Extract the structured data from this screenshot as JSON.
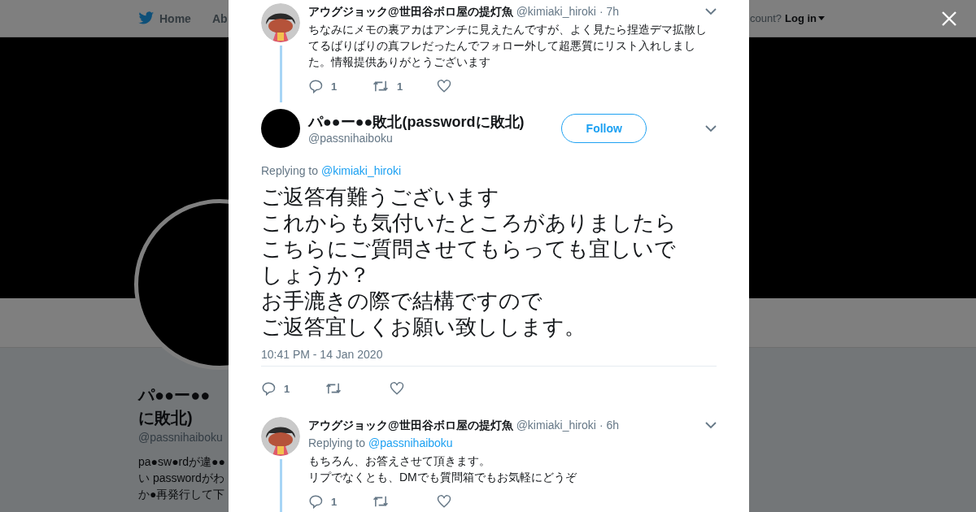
{
  "background_page": {
    "nav": {
      "items": [
        {
          "label": "Home"
        },
        {
          "label": "Ab"
        }
      ],
      "account_prompt": "count?",
      "login": "Log in"
    },
    "profile": {
      "name_lines": [
        "パ●●ー●●",
        "に敗北)"
      ],
      "handle": "@passnihaiboku",
      "bio_lines": [
        "pa●sw●rdが違●●",
        "い passwordがわ",
        "か●再発行して下"
      ]
    }
  },
  "modal": {
    "tweets": [
      {
        "kind": "reply",
        "author": "アウグジョック@世田谷ボロ屋の提灯魚",
        "handle": "@kimiaki_hiroki",
        "time": "· 7h",
        "text": "ちなみにメモの裏アカはアンチに見えたんですが、よく見たら捏造デマ拡散してるばりばりの真フレだったんでフォロー外して超悪質にリスト入れしました。情報提供ありがとうございます",
        "reply_count": "1",
        "retweet_count": "1",
        "thread_line": true
      },
      {
        "kind": "focused",
        "author": "パ●●ー●●敗北(passwordに敗北)",
        "handle": "@passnihaiboku",
        "follow": "Follow",
        "replying_label": "Replying to",
        "replying_to": "@kimiaki_hiroki",
        "text_lines": [
          "ご返答有難うございます",
          "これからも気付いたところがありましたら",
          "こちらにご質問させてもらっても宜しいで",
          "しょうか？",
          "お手漉きの際で結構ですので",
          "ご返答宜しくお願い致しします。"
        ],
        "timestamp": "10:41 PM - 14 Jan 2020",
        "reply_count": "1"
      },
      {
        "kind": "reply",
        "author": "アウグジョック@世田谷ボロ屋の提灯魚",
        "handle": "@kimiaki_hiroki",
        "time": "· 6h",
        "replying_label": "Replying to",
        "replying_to": "@passnihaiboku",
        "text_lines": [
          "もちろん、お答えさせて頂きます。",
          "リプでなくとも、DMでも質問箱でもお気軽にどうぞ"
        ],
        "reply_count": "1",
        "thread_line": true
      }
    ]
  }
}
